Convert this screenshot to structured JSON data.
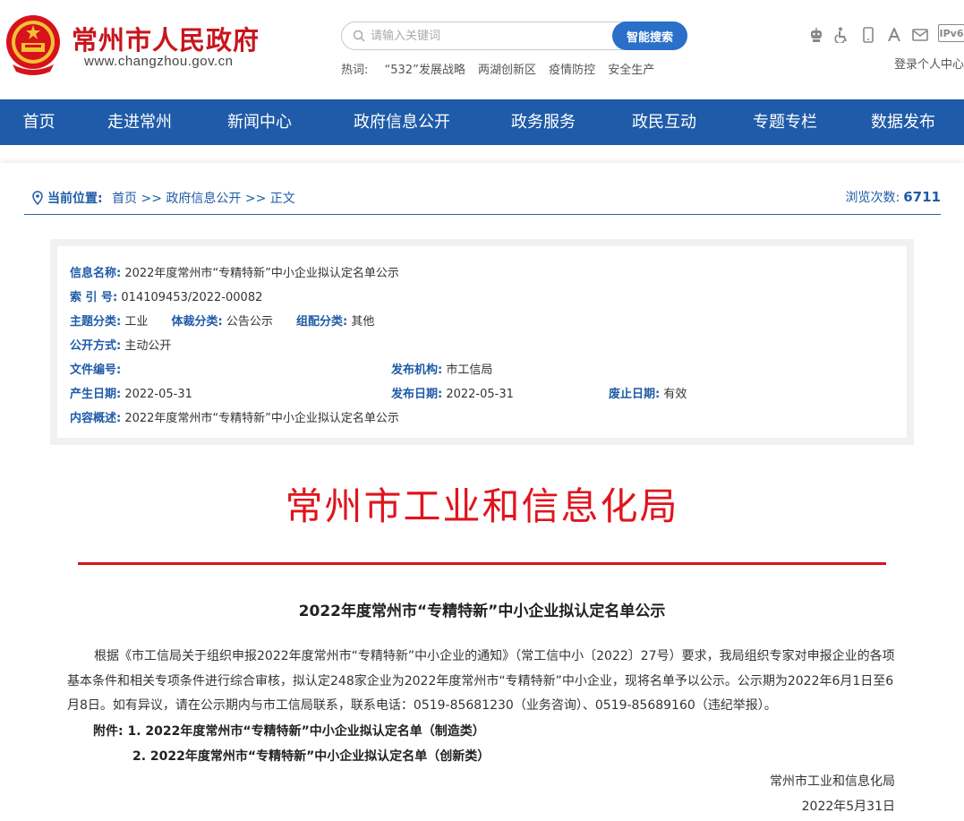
{
  "header": {
    "site_title": "常州市人民政府",
    "site_url": "www.changzhou.gov.cn",
    "search_placeholder": "请输入关键词",
    "search_button": "智能搜索",
    "hot_label": "热词:",
    "hotwords": [
      "“532”发展战略",
      "两湖创新区",
      "疫情防控",
      "安全生产"
    ],
    "ipv6": "IPv6",
    "login": "登录个人中心"
  },
  "nav": {
    "items": [
      "首页",
      "走进常州",
      "新闻中心",
      "政府信息公开",
      "政务服务",
      "政民互动",
      "专题专栏",
      "数据发布"
    ]
  },
  "breadcrumb": {
    "label": "当前位置:",
    "path": "首页 >> 政府信息公开 >> 正文",
    "views_label": "浏览次数:",
    "views_count": "6711"
  },
  "meta": {
    "name_label": "信息名称:",
    "name_value": "2022年度常州市“专精特新”中小企业拟认定名单公示",
    "index_label": "索 引 号:",
    "index_value": "014109453/2022-00082",
    "topic_label": "主题分类:",
    "topic_value": "工业",
    "genre_label": "体裁分类:",
    "genre_value": "公告公示",
    "org_cat_label": "组配分类:",
    "org_cat_value": "其他",
    "open_label": "公开方式:",
    "open_value": "主动公开",
    "docno_label": "文件编号:",
    "docno_value": "",
    "issuer_label": "发布机构:",
    "issuer_value": "市工信局",
    "created_label": "产生日期:",
    "created_value": "2022-05-31",
    "published_label": "发布日期:",
    "published_value": "2022-05-31",
    "expire_label": "废止日期:",
    "expire_value": "有效",
    "summary_label": "内容概述:",
    "summary_value": "2022年度常州市“专精特新”中小企业拟认定名单公示"
  },
  "article": {
    "org_title": "常州市工业和信息化局",
    "title": "2022年度常州市“专精特新”中小企业拟认定名单公示",
    "body": "根据《市工信局关于组织申报2022年度常州市“专精特新”中小企业的通知》（常工信中小〔2022〕27号）要求，我局组织专家对申报企业的各项基本条件和相关专项条件进行综合审核，拟认定248家企业为2022年度常州市“专精特新”中小企业，现将名单予以公示。公示期为2022年6月1日至6月8日。如有异议，请在公示期内与市工信局联系，联系电话：0519-85681230（业务咨询）、0519-85689160（违纪举报）。",
    "attach_label": "附件:",
    "attach_1": "1. 2022年度常州市“专精特新”中小企业拟认定名单（制造类）",
    "attach_2": "2. 2022年度常州市“专精特新”中小企业拟认定名单（创新类）",
    "signature": "常州市工业和信息化局",
    "date": "2022年5月31日"
  },
  "colors": {
    "nav_blue": "#1f5ba8",
    "title_red": "#c8161d",
    "rule_red": "#d8121b"
  }
}
